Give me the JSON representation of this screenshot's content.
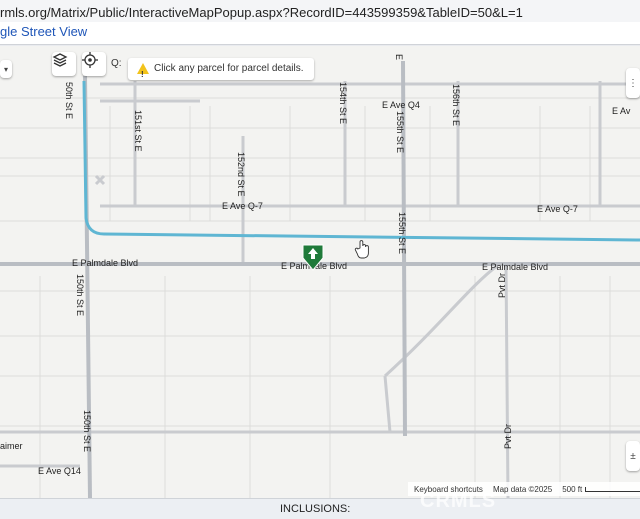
{
  "browser": {
    "url": "rmls.org/Matrix/Public/InteractiveMapPopup.aspx?RecordID=443599359&TableID=50&L=1",
    "tab_label": "gle Street View"
  },
  "map": {
    "search_fragment": "Q:",
    "tooltip_text": "Click any parcel for parcel details.",
    "streets": {
      "ave_q4": "E Ave Q4",
      "ave_q4_right": "E Av",
      "ave_q7_left": "E Ave Q-7",
      "ave_q7_right": "E Ave Q-7",
      "palmdale_left": "E Palmdale Blvd",
      "palmdale_mid": "E Palmdale Blvd",
      "palmdale_right": "E Palmdale Blvd",
      "st_150_top": "50th St E",
      "st_150_mid": "150th St E",
      "st_150_bottom": "150th St E",
      "st_151": "151st St E",
      "st_152": "152nd St E",
      "st_154": "154th St E",
      "st_155_top": "155th St E",
      "st_155_mid": "155th St E",
      "st_155_e": "E",
      "st_156": "156th St E",
      "ave_q14": "E Ave Q14",
      "pvt_dr_top": "Pvt Dr",
      "pvt_dr_bottom": "Pvt Dr",
      "aimer": "aimer"
    },
    "attribution": {
      "shortcuts": "Keyboard shortcuts",
      "map_data": "Map data ©2025",
      "scale": "500 ft"
    }
  },
  "footer": {
    "inclusions_label": "INCLUSIONS:"
  },
  "watermark": "CRMLS",
  "colors": {
    "highlight_road": "#5fb6d3",
    "marker": "#1f7a3a"
  }
}
